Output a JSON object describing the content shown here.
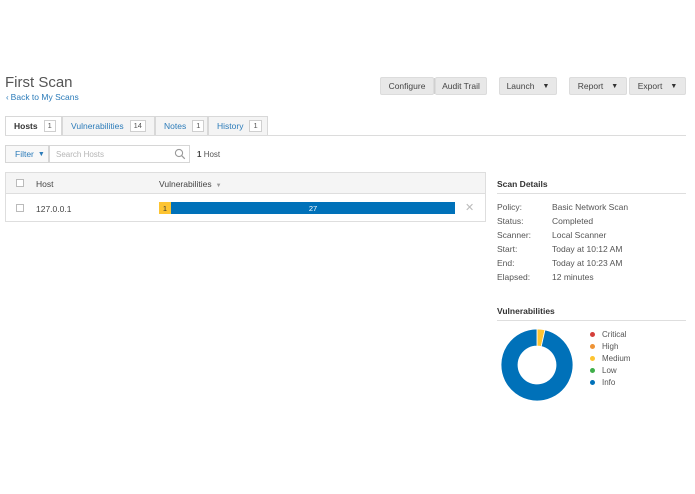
{
  "header": {
    "title": "First Scan",
    "back_link": "Back to My Scans"
  },
  "toolbar": {
    "configure": "Configure",
    "audit_trail": "Audit Trail",
    "launch": "Launch",
    "report": "Report",
    "export": "Export"
  },
  "tabs": [
    {
      "label": "Hosts",
      "count": "1",
      "active": true
    },
    {
      "label": "Vulnerabilities",
      "count": "14",
      "active": false
    },
    {
      "label": "Notes",
      "count": "1",
      "active": false
    },
    {
      "label": "History",
      "count": "1",
      "active": false
    }
  ],
  "filter": {
    "label": "Filter",
    "search_placeholder": "Search Hosts",
    "count_number": "1",
    "count_label": "Host"
  },
  "table": {
    "columns": [
      "Host",
      "Vulnerabilities"
    ],
    "rows": [
      {
        "host": "127.0.0.1",
        "vulns": [
          {
            "severity": "Medium",
            "count": "1",
            "value": 1
          },
          {
            "severity": "Info",
            "count": "27",
            "value": 27
          }
        ]
      }
    ]
  },
  "scan_details": {
    "title": "Scan Details",
    "items": [
      {
        "key": "Policy:",
        "value": "Basic Network Scan"
      },
      {
        "key": "Status:",
        "value": "Completed"
      },
      {
        "key": "Scanner:",
        "value": "Local Scanner"
      },
      {
        "key": "Start:",
        "value": "Today at 10:12 AM"
      },
      {
        "key": "End:",
        "value": "Today at 10:23 AM"
      },
      {
        "key": "Elapsed:",
        "value": "12 minutes"
      }
    ]
  },
  "vuln_summary": {
    "title": "Vulnerabilities",
    "legend": [
      {
        "label": "Critical",
        "color": "#d43f3a"
      },
      {
        "label": "High",
        "color": "#ee9336"
      },
      {
        "label": "Medium",
        "color": "#fdc431"
      },
      {
        "label": "Low",
        "color": "#3fae49"
      },
      {
        "label": "Info",
        "color": "#0071b9"
      }
    ],
    "chart_data": {
      "type": "pie",
      "categories": [
        "Critical",
        "High",
        "Medium",
        "Low",
        "Info"
      ],
      "values": [
        0,
        0,
        1,
        0,
        27
      ]
    }
  },
  "colors": {
    "accent": "#2b7bb9",
    "info": "#0071b9",
    "medium": "#fdc431"
  },
  "icons": {
    "back": "chevron-left-icon",
    "search": "search-icon",
    "caret": "caret-down-icon",
    "remove": "close-icon"
  }
}
